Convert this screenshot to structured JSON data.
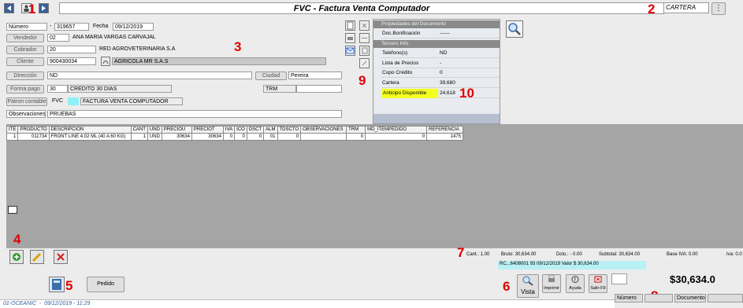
{
  "window": {
    "title": "FVC - Factura Venta Computador",
    "module": "CARTERA"
  },
  "markers": [
    "1",
    "2",
    "3",
    "4",
    "5",
    "6",
    "7",
    "8",
    "9",
    "10"
  ],
  "form": {
    "numero_label": "Número",
    "numero_prefix": "-",
    "numero_value": "319657",
    "fecha_label": "Fecha",
    "fecha_value": "09/12/2019",
    "vendedor_label": "Vendedor",
    "vendedor_code": "02",
    "vendedor_name": "ANA MARIA VARGAS CARVAJAL",
    "cobrador_label": "Cobrador",
    "cobrador_code": "20",
    "cobrador_name": "RED AGROVETERINARIA S.A",
    "cliente_label": "Cliente",
    "cliente_code": "900430034",
    "cliente_name": "AGRICOLA MR S.A.S",
    "direccion_label": "Dirección",
    "direccion_value": "ND",
    "ciudad_label": "Ciudad",
    "ciudad_value": "Pereira",
    "formapago_label": "Forma pago",
    "formapago_code": "30",
    "formapago_name": "CREDITO 30 DIAS",
    "trm_label": "TRM",
    "patron_label": "Patron contable",
    "patron_code": "FVC",
    "patron_name": "FACTURA VENTA COMPUTADOR",
    "observaciones_label": "Observaciones",
    "observaciones_value": "PRUEBAS"
  },
  "properties": {
    "section1": "Propiedades del Documento",
    "bonificacion_label": "Doc.Bonificación",
    "bonificacion_value": "------",
    "section2": "Tercero Info",
    "rows": [
      {
        "k": "Teléfono(s)",
        "v": "ND"
      },
      {
        "k": "Lista de Precios",
        "v": "-"
      },
      {
        "k": "Cupo Crédito",
        "v": "0"
      },
      {
        "k": "Cartera",
        "v": "39,680"
      },
      {
        "k": "Anticipo Disponible",
        "v": "24,618"
      }
    ]
  },
  "grid": {
    "headers": [
      "ITE",
      "PRODUCTO",
      "DESCRIPCION",
      "CANT",
      "UND",
      "PRECIOU",
      "PRECIOT",
      "IVA",
      "ICO",
      "DSCT",
      "ALM",
      "TDSCTO",
      "OBSERVACIONES",
      "TRM",
      "MD_ITEMPEDIDO",
      "REFERENCIA"
    ],
    "rows": [
      [
        "1",
        "011734",
        "FRONT LINE 4,02 ML (40 A 60 KG)",
        "1",
        "UND",
        "30634",
        "30634",
        "0",
        "0",
        "0",
        "01",
        "0",
        "",
        "0",
        "0",
        "1475"
      ]
    ]
  },
  "totals": {
    "cant": "Cant.: 1.00",
    "bruto": "Bruto: 30,634.00",
    "dcto": "Dcto.: - 0.00",
    "subtotal": "Subtotal: 30,634.00",
    "base_iva": "Base IVA: 0.00",
    "iva": "Iva: 0.0",
    "rc_line": "RC...6408001 93 09/12/2019 Valor $ 30,634.00",
    "grand_total": "$30,634.0"
  },
  "footer": {
    "pedido_label": "Pedido",
    "vista_label": "Vista",
    "imprimir_label": "Imprimir",
    "ayuda_label": "Ayuda",
    "salir_label": "Salir-F9",
    "numero_label": "Número",
    "documento_label": "Documento",
    "status_line": "01-OCEANIC  -  09/12/2019 - 11:29"
  }
}
